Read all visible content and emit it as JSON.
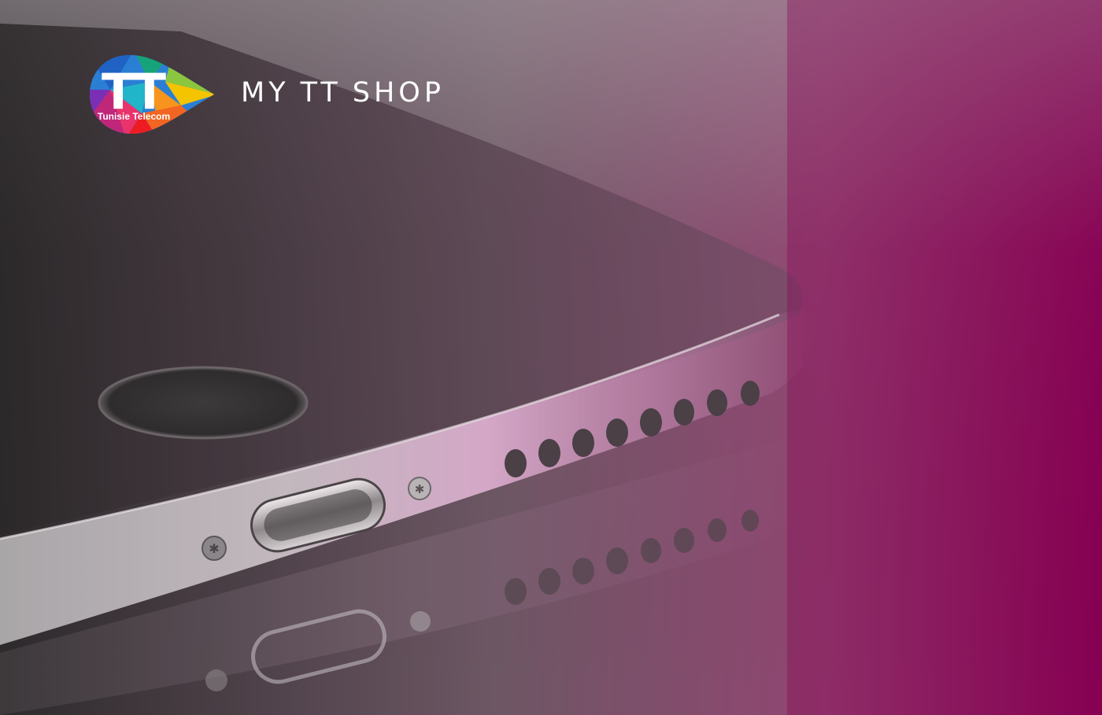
{
  "brand": {
    "logo_text": "TT",
    "logo_subtext": "Tunisie Telecom",
    "title_words": [
      "MY",
      "TT",
      "SHOP"
    ]
  },
  "colors": {
    "gradient_left": "#3a3437",
    "gradient_mid": "#8f6a7f",
    "gradient_right": "#8a0050",
    "logo_text": "#ffffff"
  }
}
